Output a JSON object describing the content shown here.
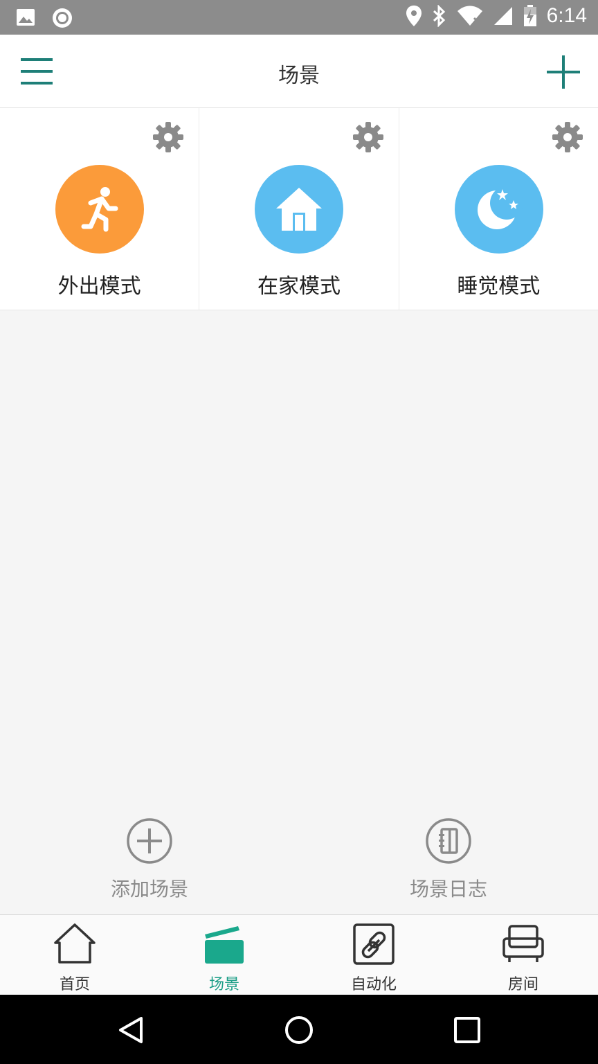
{
  "status_bar": {
    "time": "6:14"
  },
  "app_bar": {
    "title": "场景"
  },
  "scenes": [
    {
      "label": "外出模式",
      "color": "#fb9b3a",
      "icon": "running-person-icon"
    },
    {
      "label": "在家模式",
      "color": "#5bbdf0",
      "icon": "home-icon"
    },
    {
      "label": "睡觉模式",
      "color": "#5bbdf0",
      "icon": "moon-stars-icon"
    }
  ],
  "actions": {
    "add_scene": "添加场景",
    "scene_log": "场景日志"
  },
  "tabs": [
    {
      "label": "首页",
      "icon": "house-icon",
      "active": false
    },
    {
      "label": "场景",
      "icon": "clapperboard-icon",
      "active": true
    },
    {
      "label": "自动化",
      "icon": "link-icon",
      "active": false
    },
    {
      "label": "房间",
      "icon": "sofa-icon",
      "active": false
    }
  ],
  "colors": {
    "accent": "#1a9e86",
    "menu": "#1e7f78",
    "gear": "#8a8a8a"
  }
}
